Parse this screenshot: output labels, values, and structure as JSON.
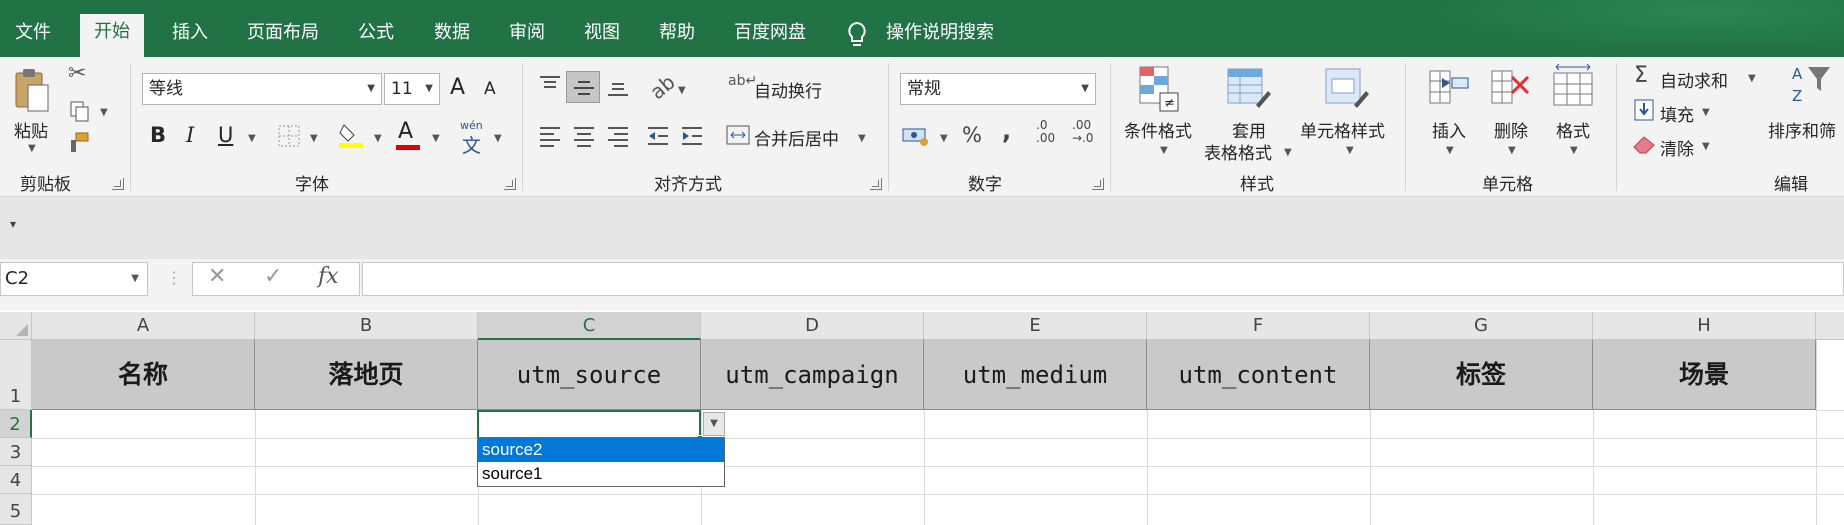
{
  "tabs": [
    "文件",
    "开始",
    "插入",
    "页面布局",
    "公式",
    "数据",
    "审阅",
    "视图",
    "帮助",
    "百度网盘"
  ],
  "active_tab": "开始",
  "tell_me": "操作说明搜索",
  "ribbon": {
    "clipboard": {
      "paste": "粘贴",
      "label": "剪贴板"
    },
    "font": {
      "name": "等线",
      "size": "11",
      "grow": "A",
      "shrink": "A",
      "bold": "B",
      "italic": "I",
      "underline": "U",
      "phonetic_top": "wén",
      "phonetic_bottom": "文",
      "label": "字体"
    },
    "alignment": {
      "wrap": "自动换行",
      "merge": "合并后居中",
      "label": "对齐方式"
    },
    "number": {
      "format": "常规",
      "percent": "%",
      "comma": ",",
      "inc_dec_top": ".0",
      "inc_dec_bottom": ".00",
      "dec_dec_top": ".00",
      "dec_dec_bottom": "→.0",
      "label": "数字"
    },
    "styles": {
      "conditional": "条件格式",
      "table_l1": "套用",
      "table_l2": "表格格式",
      "cell": "单元格样式",
      "label": "样式"
    },
    "cells": {
      "insert": "插入",
      "delete": "删除",
      "format": "格式",
      "label": "单元格"
    },
    "editing": {
      "autosum": "自动求和",
      "fill": "填充",
      "clear": "清除",
      "sort": "排序和筛",
      "label": "编辑"
    }
  },
  "formula_bar": {
    "name_box": "C2",
    "fx": "fx",
    "content": ""
  },
  "columns": [
    "A",
    "B",
    "C",
    "D",
    "E",
    "F",
    "G",
    "H"
  ],
  "rows": [
    "1",
    "2",
    "3",
    "4",
    "5"
  ],
  "header_row": [
    "名称",
    "落地页",
    "utm_source",
    "utm_campaign",
    "utm_medium",
    "utm_content",
    "标签",
    "场景"
  ],
  "dropdown": {
    "options": [
      "source2",
      "source1"
    ],
    "highlighted": "source2"
  },
  "colors": {
    "accent": "#217346",
    "header_fill": "#c9c9c9",
    "selection": "#0078d7"
  }
}
